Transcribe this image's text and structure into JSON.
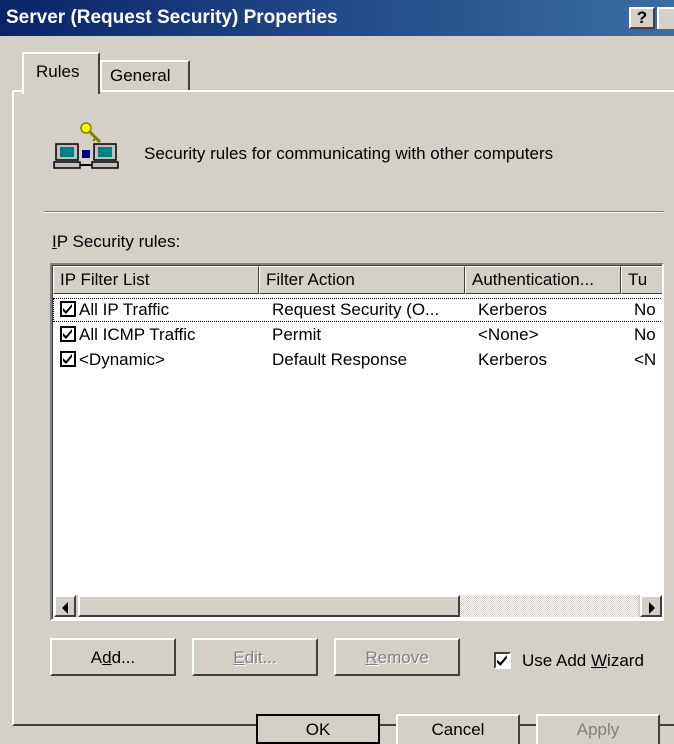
{
  "window": {
    "title": "Server (Request Security) Properties",
    "help_label": "?"
  },
  "tabs": [
    {
      "label": "Rules",
      "selected": true
    },
    {
      "label": "General",
      "selected": false
    }
  ],
  "header": {
    "text": "Security rules for communicating with other computers",
    "icon": "ip-security-network-icon"
  },
  "rules_label": {
    "prefix": "I",
    "rest": "P Security rules:"
  },
  "table": {
    "columns": [
      "IP Filter List",
      "Filter Action",
      "Authentication...",
      "Tu"
    ],
    "rows": [
      {
        "checked": true,
        "filter_list": "All IP Traffic",
        "filter_action": "Request Security (O...",
        "authentication": "Kerberos",
        "tunnel": "No"
      },
      {
        "checked": true,
        "filter_list": "All ICMP Traffic",
        "filter_action": "Permit",
        "authentication": "<None>",
        "tunnel": "No"
      },
      {
        "checked": true,
        "filter_list": "<Dynamic>",
        "filter_action": "Default Response",
        "authentication": "Kerberos",
        "tunnel": "<N"
      }
    ]
  },
  "buttons": {
    "add": {
      "pre": "A",
      "mnemonic": "d",
      "post": "d..."
    },
    "edit": {
      "pre": "",
      "mnemonic": "E",
      "post": "dit..."
    },
    "remove": {
      "pre": "",
      "mnemonic": "R",
      "post": "emove"
    }
  },
  "wizard": {
    "checked": true,
    "pre": "Use Add ",
    "mnemonic": "W",
    "post": "izard"
  },
  "footer": {
    "ok": "OK",
    "cancel": "Cancel",
    "apply": "Apply"
  }
}
